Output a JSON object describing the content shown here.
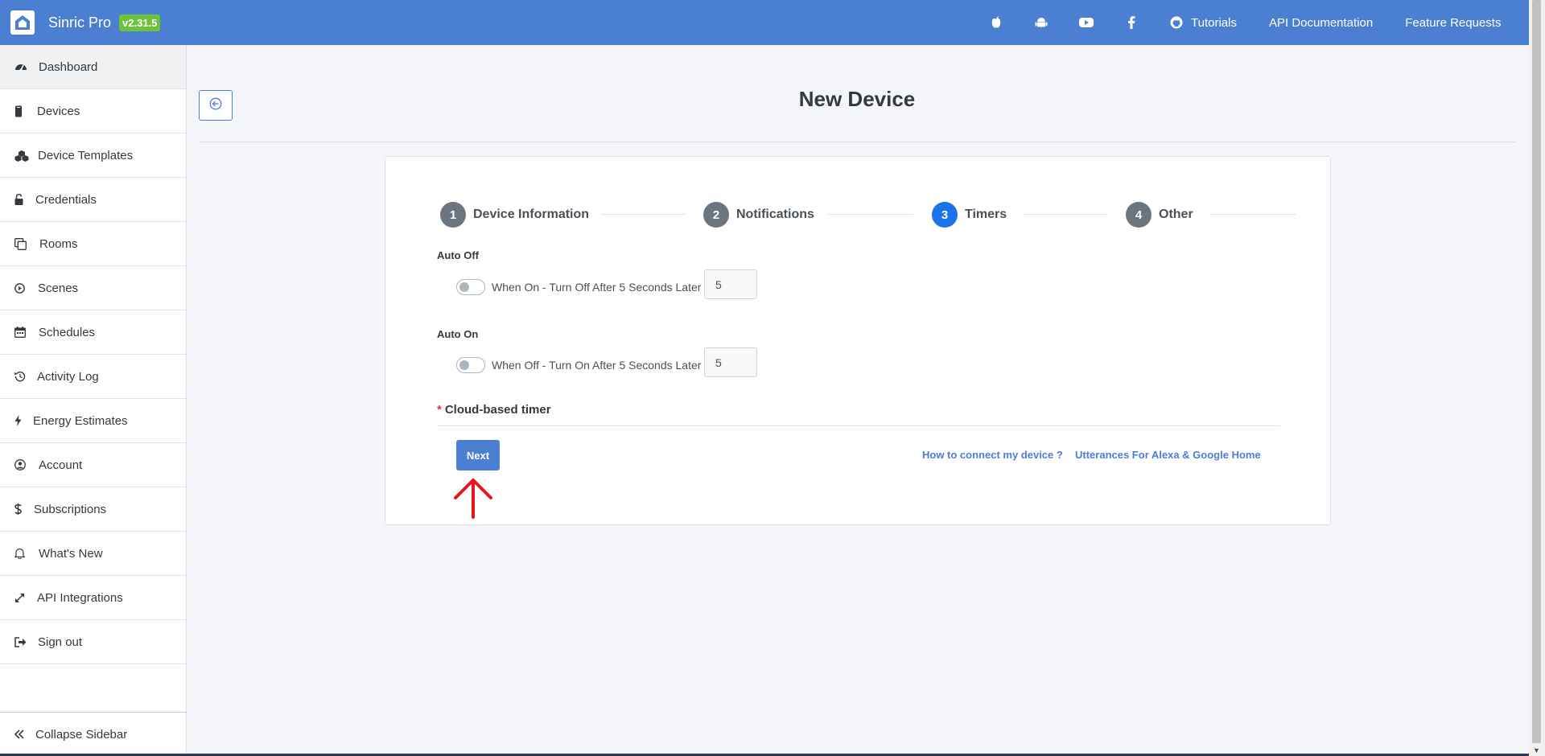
{
  "header": {
    "brand": "Sinric Pro",
    "version": "v2.31.5",
    "icons": [
      "apple-icon",
      "android-icon",
      "youtube-icon",
      "facebook-icon",
      "github-icon"
    ],
    "links": [
      "Tutorials",
      "API Documentation",
      "Feature Requests"
    ]
  },
  "sidebar": {
    "items": [
      {
        "label": "Dashboard",
        "icon": "dashboard-icon",
        "active": true
      },
      {
        "label": "Devices",
        "icon": "device-icon"
      },
      {
        "label": "Device Templates",
        "icon": "templates-icon"
      },
      {
        "label": "Credentials",
        "icon": "unlock-icon"
      },
      {
        "label": "Rooms",
        "icon": "rooms-icon"
      },
      {
        "label": "Scenes",
        "icon": "scenes-icon"
      },
      {
        "label": "Schedules",
        "icon": "calendar-icon"
      },
      {
        "label": "Activity Log",
        "icon": "history-icon"
      },
      {
        "label": "Energy Estimates",
        "icon": "bolt-icon"
      },
      {
        "label": "Account",
        "icon": "user-circle-icon"
      },
      {
        "label": "Subscriptions",
        "icon": "dollar-icon"
      },
      {
        "label": "What's New",
        "icon": "bell-icon"
      },
      {
        "label": "API Integrations",
        "icon": "expand-icon"
      },
      {
        "label": "Sign out",
        "icon": "sign-out-icon"
      }
    ],
    "collapse_label": "Collapse Sidebar"
  },
  "main": {
    "title": "New Device",
    "steps": [
      {
        "number": "1",
        "label": "Device Information",
        "active": false
      },
      {
        "number": "2",
        "label": "Notifications",
        "active": false
      },
      {
        "number": "3",
        "label": "Timers",
        "active": true
      },
      {
        "number": "4",
        "label": "Other",
        "active": false
      }
    ],
    "auto_off": {
      "label": "Auto Off",
      "toggle_text": "When On - Turn Off After 5 Seconds Later",
      "value": "5",
      "enabled": false
    },
    "auto_on": {
      "label": "Auto On",
      "toggle_text": "When Off - Turn On After 5 Seconds Later",
      "value": "5",
      "enabled": false
    },
    "cloud_required": "*",
    "cloud_label": "Cloud-based timer",
    "next_label": "Next",
    "help_links": [
      "How to connect my device ?",
      "Utterances For Alexa & Google Home"
    ]
  },
  "colors": {
    "header_bg": "#4a7fd1",
    "version_badge": "#6cc23a",
    "active_step": "#1a73e8",
    "annotation_arrow": "#e8141c"
  }
}
